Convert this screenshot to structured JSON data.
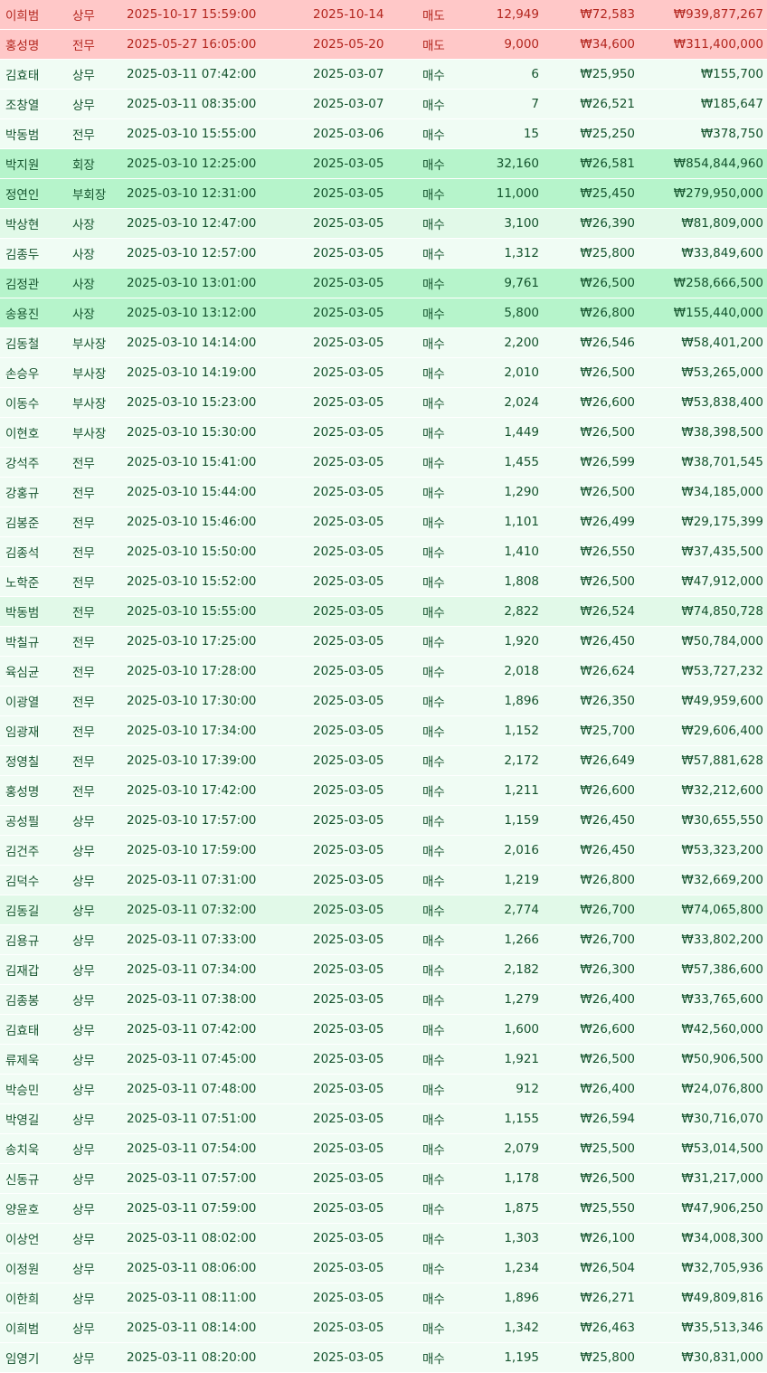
{
  "colors": {
    "sell_row": "#ffc8c8",
    "sell_text": "#b3261e",
    "buy_large_row": "#b6f4cb",
    "buy_medium_row": "#e1f9e8",
    "buy_small_row": "#f0fcf4",
    "buy_text": "#14532d"
  },
  "rows": [
    {
      "name": "이희범",
      "rank": "상무",
      "report_time": "2025-10-17 15:59:00",
      "trade_date": "2025-10-14",
      "type": "매도",
      "qty": "12,949",
      "price": "₩72,583",
      "amount": "₩939,877,267",
      "tier": "sell"
    },
    {
      "name": "홍성명",
      "rank": "전무",
      "report_time": "2025-05-27 16:05:00",
      "trade_date": "2025-05-20",
      "type": "매도",
      "qty": "9,000",
      "price": "₩34,600",
      "amount": "₩311,400,000",
      "tier": "sell"
    },
    {
      "name": "김효태",
      "rank": "상무",
      "report_time": "2025-03-11 07:42:00",
      "trade_date": "2025-03-07",
      "type": "매수",
      "qty": "6",
      "price": "₩25,950",
      "amount": "₩155,700",
      "tier": "small"
    },
    {
      "name": "조창열",
      "rank": "상무",
      "report_time": "2025-03-11 08:35:00",
      "trade_date": "2025-03-07",
      "type": "매수",
      "qty": "7",
      "price": "₩26,521",
      "amount": "₩185,647",
      "tier": "small"
    },
    {
      "name": "박동범",
      "rank": "전무",
      "report_time": "2025-03-10 15:55:00",
      "trade_date": "2025-03-06",
      "type": "매수",
      "qty": "15",
      "price": "₩25,250",
      "amount": "₩378,750",
      "tier": "small"
    },
    {
      "name": "박지원",
      "rank": "회장",
      "report_time": "2025-03-10 12:25:00",
      "trade_date": "2025-03-05",
      "type": "매수",
      "qty": "32,160",
      "price": "₩26,581",
      "amount": "₩854,844,960",
      "tier": "big"
    },
    {
      "name": "정연인",
      "rank": "부회장",
      "report_time": "2025-03-10 12:31:00",
      "trade_date": "2025-03-05",
      "type": "매수",
      "qty": "11,000",
      "price": "₩25,450",
      "amount": "₩279,950,000",
      "tier": "big"
    },
    {
      "name": "박상현",
      "rank": "사장",
      "report_time": "2025-03-10 12:47:00",
      "trade_date": "2025-03-05",
      "type": "매수",
      "qty": "3,100",
      "price": "₩26,390",
      "amount": "₩81,809,000",
      "tier": "mid"
    },
    {
      "name": "김종두",
      "rank": "사장",
      "report_time": "2025-03-10 12:57:00",
      "trade_date": "2025-03-05",
      "type": "매수",
      "qty": "1,312",
      "price": "₩25,800",
      "amount": "₩33,849,600",
      "tier": "small"
    },
    {
      "name": "김정관",
      "rank": "사장",
      "report_time": "2025-03-10 13:01:00",
      "trade_date": "2025-03-05",
      "type": "매수",
      "qty": "9,761",
      "price": "₩26,500",
      "amount": "₩258,666,500",
      "tier": "big"
    },
    {
      "name": "송용진",
      "rank": "사장",
      "report_time": "2025-03-10 13:12:00",
      "trade_date": "2025-03-05",
      "type": "매수",
      "qty": "5,800",
      "price": "₩26,800",
      "amount": "₩155,440,000",
      "tier": "big"
    },
    {
      "name": "김동철",
      "rank": "부사장",
      "report_time": "2025-03-10 14:14:00",
      "trade_date": "2025-03-05",
      "type": "매수",
      "qty": "2,200",
      "price": "₩26,546",
      "amount": "₩58,401,200",
      "tier": "small"
    },
    {
      "name": "손승우",
      "rank": "부사장",
      "report_time": "2025-03-10 14:19:00",
      "trade_date": "2025-03-05",
      "type": "매수",
      "qty": "2,010",
      "price": "₩26,500",
      "amount": "₩53,265,000",
      "tier": "small"
    },
    {
      "name": "이동수",
      "rank": "부사장",
      "report_time": "2025-03-10 15:23:00",
      "trade_date": "2025-03-05",
      "type": "매수",
      "qty": "2,024",
      "price": "₩26,600",
      "amount": "₩53,838,400",
      "tier": "small"
    },
    {
      "name": "이현호",
      "rank": "부사장",
      "report_time": "2025-03-10 15:30:00",
      "trade_date": "2025-03-05",
      "type": "매수",
      "qty": "1,449",
      "price": "₩26,500",
      "amount": "₩38,398,500",
      "tier": "small"
    },
    {
      "name": "강석주",
      "rank": "전무",
      "report_time": "2025-03-10 15:41:00",
      "trade_date": "2025-03-05",
      "type": "매수",
      "qty": "1,455",
      "price": "₩26,599",
      "amount": "₩38,701,545",
      "tier": "small"
    },
    {
      "name": "강홍규",
      "rank": "전무",
      "report_time": "2025-03-10 15:44:00",
      "trade_date": "2025-03-05",
      "type": "매수",
      "qty": "1,290",
      "price": "₩26,500",
      "amount": "₩34,185,000",
      "tier": "small"
    },
    {
      "name": "김봉준",
      "rank": "전무",
      "report_time": "2025-03-10 15:46:00",
      "trade_date": "2025-03-05",
      "type": "매수",
      "qty": "1,101",
      "price": "₩26,499",
      "amount": "₩29,175,399",
      "tier": "small"
    },
    {
      "name": "김종석",
      "rank": "전무",
      "report_time": "2025-03-10 15:50:00",
      "trade_date": "2025-03-05",
      "type": "매수",
      "qty": "1,410",
      "price": "₩26,550",
      "amount": "₩37,435,500",
      "tier": "small"
    },
    {
      "name": "노학준",
      "rank": "전무",
      "report_time": "2025-03-10 15:52:00",
      "trade_date": "2025-03-05",
      "type": "매수",
      "qty": "1,808",
      "price": "₩26,500",
      "amount": "₩47,912,000",
      "tier": "small"
    },
    {
      "name": "박동범",
      "rank": "전무",
      "report_time": "2025-03-10 15:55:00",
      "trade_date": "2025-03-05",
      "type": "매수",
      "qty": "2,822",
      "price": "₩26,524",
      "amount": "₩74,850,728",
      "tier": "mid"
    },
    {
      "name": "박칠규",
      "rank": "전무",
      "report_time": "2025-03-10 17:25:00",
      "trade_date": "2025-03-05",
      "type": "매수",
      "qty": "1,920",
      "price": "₩26,450",
      "amount": "₩50,784,000",
      "tier": "small"
    },
    {
      "name": "육심균",
      "rank": "전무",
      "report_time": "2025-03-10 17:28:00",
      "trade_date": "2025-03-05",
      "type": "매수",
      "qty": "2,018",
      "price": "₩26,624",
      "amount": "₩53,727,232",
      "tier": "small"
    },
    {
      "name": "이광열",
      "rank": "전무",
      "report_time": "2025-03-10 17:30:00",
      "trade_date": "2025-03-05",
      "type": "매수",
      "qty": "1,896",
      "price": "₩26,350",
      "amount": "₩49,959,600",
      "tier": "small"
    },
    {
      "name": "임광재",
      "rank": "전무",
      "report_time": "2025-03-10 17:34:00",
      "trade_date": "2025-03-05",
      "type": "매수",
      "qty": "1,152",
      "price": "₩25,700",
      "amount": "₩29,606,400",
      "tier": "small"
    },
    {
      "name": "정영칠",
      "rank": "전무",
      "report_time": "2025-03-10 17:39:00",
      "trade_date": "2025-03-05",
      "type": "매수",
      "qty": "2,172",
      "price": "₩26,649",
      "amount": "₩57,881,628",
      "tier": "small"
    },
    {
      "name": "홍성명",
      "rank": "전무",
      "report_time": "2025-03-10 17:42:00",
      "trade_date": "2025-03-05",
      "type": "매수",
      "qty": "1,211",
      "price": "₩26,600",
      "amount": "₩32,212,600",
      "tier": "small"
    },
    {
      "name": "공성필",
      "rank": "상무",
      "report_time": "2025-03-10 17:57:00",
      "trade_date": "2025-03-05",
      "type": "매수",
      "qty": "1,159",
      "price": "₩26,450",
      "amount": "₩30,655,550",
      "tier": "small"
    },
    {
      "name": "김건주",
      "rank": "상무",
      "report_time": "2025-03-10 17:59:00",
      "trade_date": "2025-03-05",
      "type": "매수",
      "qty": "2,016",
      "price": "₩26,450",
      "amount": "₩53,323,200",
      "tier": "small"
    },
    {
      "name": "김덕수",
      "rank": "상무",
      "report_time": "2025-03-11 07:31:00",
      "trade_date": "2025-03-05",
      "type": "매수",
      "qty": "1,219",
      "price": "₩26,800",
      "amount": "₩32,669,200",
      "tier": "small"
    },
    {
      "name": "김동길",
      "rank": "상무",
      "report_time": "2025-03-11 07:32:00",
      "trade_date": "2025-03-05",
      "type": "매수",
      "qty": "2,774",
      "price": "₩26,700",
      "amount": "₩74,065,800",
      "tier": "mid"
    },
    {
      "name": "김용규",
      "rank": "상무",
      "report_time": "2025-03-11 07:33:00",
      "trade_date": "2025-03-05",
      "type": "매수",
      "qty": "1,266",
      "price": "₩26,700",
      "amount": "₩33,802,200",
      "tier": "small"
    },
    {
      "name": "김재갑",
      "rank": "상무",
      "report_time": "2025-03-11 07:34:00",
      "trade_date": "2025-03-05",
      "type": "매수",
      "qty": "2,182",
      "price": "₩26,300",
      "amount": "₩57,386,600",
      "tier": "small"
    },
    {
      "name": "김종봉",
      "rank": "상무",
      "report_time": "2025-03-11 07:38:00",
      "trade_date": "2025-03-05",
      "type": "매수",
      "qty": "1,279",
      "price": "₩26,400",
      "amount": "₩33,765,600",
      "tier": "small"
    },
    {
      "name": "김효태",
      "rank": "상무",
      "report_time": "2025-03-11 07:42:00",
      "trade_date": "2025-03-05",
      "type": "매수",
      "qty": "1,600",
      "price": "₩26,600",
      "amount": "₩42,560,000",
      "tier": "small"
    },
    {
      "name": "류제욱",
      "rank": "상무",
      "report_time": "2025-03-11 07:45:00",
      "trade_date": "2025-03-05",
      "type": "매수",
      "qty": "1,921",
      "price": "₩26,500",
      "amount": "₩50,906,500",
      "tier": "small"
    },
    {
      "name": "박승민",
      "rank": "상무",
      "report_time": "2025-03-11 07:48:00",
      "trade_date": "2025-03-05",
      "type": "매수",
      "qty": "912",
      "price": "₩26,400",
      "amount": "₩24,076,800",
      "tier": "small"
    },
    {
      "name": "박영길",
      "rank": "상무",
      "report_time": "2025-03-11 07:51:00",
      "trade_date": "2025-03-05",
      "type": "매수",
      "qty": "1,155",
      "price": "₩26,594",
      "amount": "₩30,716,070",
      "tier": "small"
    },
    {
      "name": "송치욱",
      "rank": "상무",
      "report_time": "2025-03-11 07:54:00",
      "trade_date": "2025-03-05",
      "type": "매수",
      "qty": "2,079",
      "price": "₩25,500",
      "amount": "₩53,014,500",
      "tier": "small"
    },
    {
      "name": "신동규",
      "rank": "상무",
      "report_time": "2025-03-11 07:57:00",
      "trade_date": "2025-03-05",
      "type": "매수",
      "qty": "1,178",
      "price": "₩26,500",
      "amount": "₩31,217,000",
      "tier": "small"
    },
    {
      "name": "양윤호",
      "rank": "상무",
      "report_time": "2025-03-11 07:59:00",
      "trade_date": "2025-03-05",
      "type": "매수",
      "qty": "1,875",
      "price": "₩25,550",
      "amount": "₩47,906,250",
      "tier": "small"
    },
    {
      "name": "이상언",
      "rank": "상무",
      "report_time": "2025-03-11 08:02:00",
      "trade_date": "2025-03-05",
      "type": "매수",
      "qty": "1,303",
      "price": "₩26,100",
      "amount": "₩34,008,300",
      "tier": "small"
    },
    {
      "name": "이정원",
      "rank": "상무",
      "report_time": "2025-03-11 08:06:00",
      "trade_date": "2025-03-05",
      "type": "매수",
      "qty": "1,234",
      "price": "₩26,504",
      "amount": "₩32,705,936",
      "tier": "small"
    },
    {
      "name": "이한희",
      "rank": "상무",
      "report_time": "2025-03-11 08:11:00",
      "trade_date": "2025-03-05",
      "type": "매수",
      "qty": "1,896",
      "price": "₩26,271",
      "amount": "₩49,809,816",
      "tier": "small"
    },
    {
      "name": "이희범",
      "rank": "상무",
      "report_time": "2025-03-11 08:14:00",
      "trade_date": "2025-03-05",
      "type": "매수",
      "qty": "1,342",
      "price": "₩26,463",
      "amount": "₩35,513,346",
      "tier": "small"
    },
    {
      "name": "임영기",
      "rank": "상무",
      "report_time": "2025-03-11 08:20:00",
      "trade_date": "2025-03-05",
      "type": "매수",
      "qty": "1,195",
      "price": "₩25,800",
      "amount": "₩30,831,000",
      "tier": "small"
    }
  ]
}
